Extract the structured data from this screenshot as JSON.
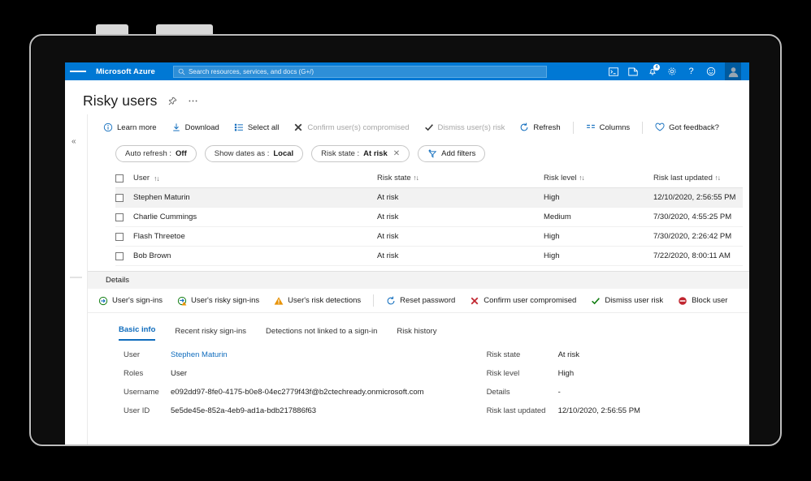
{
  "azure_bar": {
    "brand": "Microsoft Azure",
    "search_placeholder": "Search resources, services, and docs (G+/)",
    "notification_count": "4",
    "icons": [
      "cloud-shell-icon",
      "directories-icon",
      "notifications-icon",
      "settings-gear-icon",
      "help-icon",
      "feedback-icon",
      "account-avatar"
    ]
  },
  "page": {
    "title": "Risky users",
    "pin_label": "Pin",
    "more_label": "More"
  },
  "command_bar": {
    "items": [
      {
        "label": "Learn more",
        "icon": "info-icon",
        "disabled": false
      },
      {
        "label": "Download",
        "icon": "download-icon",
        "disabled": false
      },
      {
        "label": "Select all",
        "icon": "select-all-icon",
        "disabled": false
      },
      {
        "label": "Confirm user(s) compromised",
        "icon": "x-mark-icon",
        "disabled": true
      },
      {
        "label": "Dismiss user(s) risk",
        "icon": "check-mark-icon",
        "disabled": true
      },
      {
        "label": "Refresh",
        "icon": "refresh-icon",
        "disabled": false
      },
      {
        "label": "Columns",
        "icon": "columns-icon",
        "disabled": false
      },
      {
        "label": "Got feedback?",
        "icon": "heart-icon",
        "disabled": false
      }
    ]
  },
  "filters": {
    "pills": [
      {
        "label": "Auto refresh : ",
        "value": "Off",
        "removable": false
      },
      {
        "label": "Show dates as : ",
        "value": "Local",
        "removable": false
      },
      {
        "label": "Risk state : ",
        "value": "At risk",
        "removable": true
      }
    ],
    "add_filters": "Add filters"
  },
  "table": {
    "columns": [
      "User",
      "Risk state",
      "Risk level",
      "Risk last updated"
    ],
    "rows": [
      {
        "user": "Stephen Maturin",
        "risk_state": "At risk",
        "risk_level": "High",
        "risk_last_updated": "12/10/2020, 2:56:55 PM",
        "selected": true
      },
      {
        "user": "Charlie Cummings",
        "risk_state": "At risk",
        "risk_level": "Medium",
        "risk_last_updated": "7/30/2020, 4:55:25 PM",
        "selected": false
      },
      {
        "user": "Flash Threetoe",
        "risk_state": "At risk",
        "risk_level": "High",
        "risk_last_updated": "7/30/2020, 2:26:42 PM",
        "selected": false
      },
      {
        "user": "Bob Brown",
        "risk_state": "At risk",
        "risk_level": "High",
        "risk_last_updated": "7/22/2020, 8:00:11 AM",
        "selected": false
      }
    ]
  },
  "details": {
    "header": "Details",
    "commands": [
      {
        "label": "User's sign-ins",
        "icon": "sign-ins-icon"
      },
      {
        "label": "User's risky sign-ins",
        "icon": "risky-sign-ins-icon"
      },
      {
        "label": "User's risk detections",
        "icon": "warning-triangle-icon"
      },
      {
        "label": "Reset password",
        "icon": "refresh-icon"
      },
      {
        "label": "Confirm user compromised",
        "icon": "red-x-icon"
      },
      {
        "label": "Dismiss user risk",
        "icon": "green-check-icon"
      },
      {
        "label": "Block user",
        "icon": "block-icon"
      }
    ],
    "tabs": [
      {
        "label": "Basic info",
        "active": true
      },
      {
        "label": "Recent risky sign-ins",
        "active": false
      },
      {
        "label": "Detections not linked to a sign-in",
        "active": false
      },
      {
        "label": "Risk history",
        "active": false
      }
    ],
    "fields_left": [
      {
        "label": "User",
        "value": "Stephen Maturin",
        "is_link": true
      },
      {
        "label": "Roles",
        "value": "User",
        "is_link": false
      },
      {
        "label": "Username",
        "value": "e092dd97-8fe0-4175-b0e8-04ec2779f43f@b2ctechready.onmicrosoft.com",
        "is_link": false
      },
      {
        "label": "User ID",
        "value": "5e5de45e-852a-4eb9-ad1a-bdb217886f63",
        "is_link": false
      }
    ],
    "fields_right": [
      {
        "label": "Risk state",
        "value": "At risk"
      },
      {
        "label": "Risk level",
        "value": "High"
      },
      {
        "label": "Details",
        "value": "-"
      },
      {
        "label": "Risk last updated",
        "value": "12/10/2020, 2:56:55 PM"
      }
    ]
  },
  "colors": {
    "azure_blue": "#0078d4",
    "link_blue": "#0f6cbd",
    "danger_red": "#c0252f",
    "success_green": "#107c10",
    "warning_orange": "#e8940a"
  }
}
